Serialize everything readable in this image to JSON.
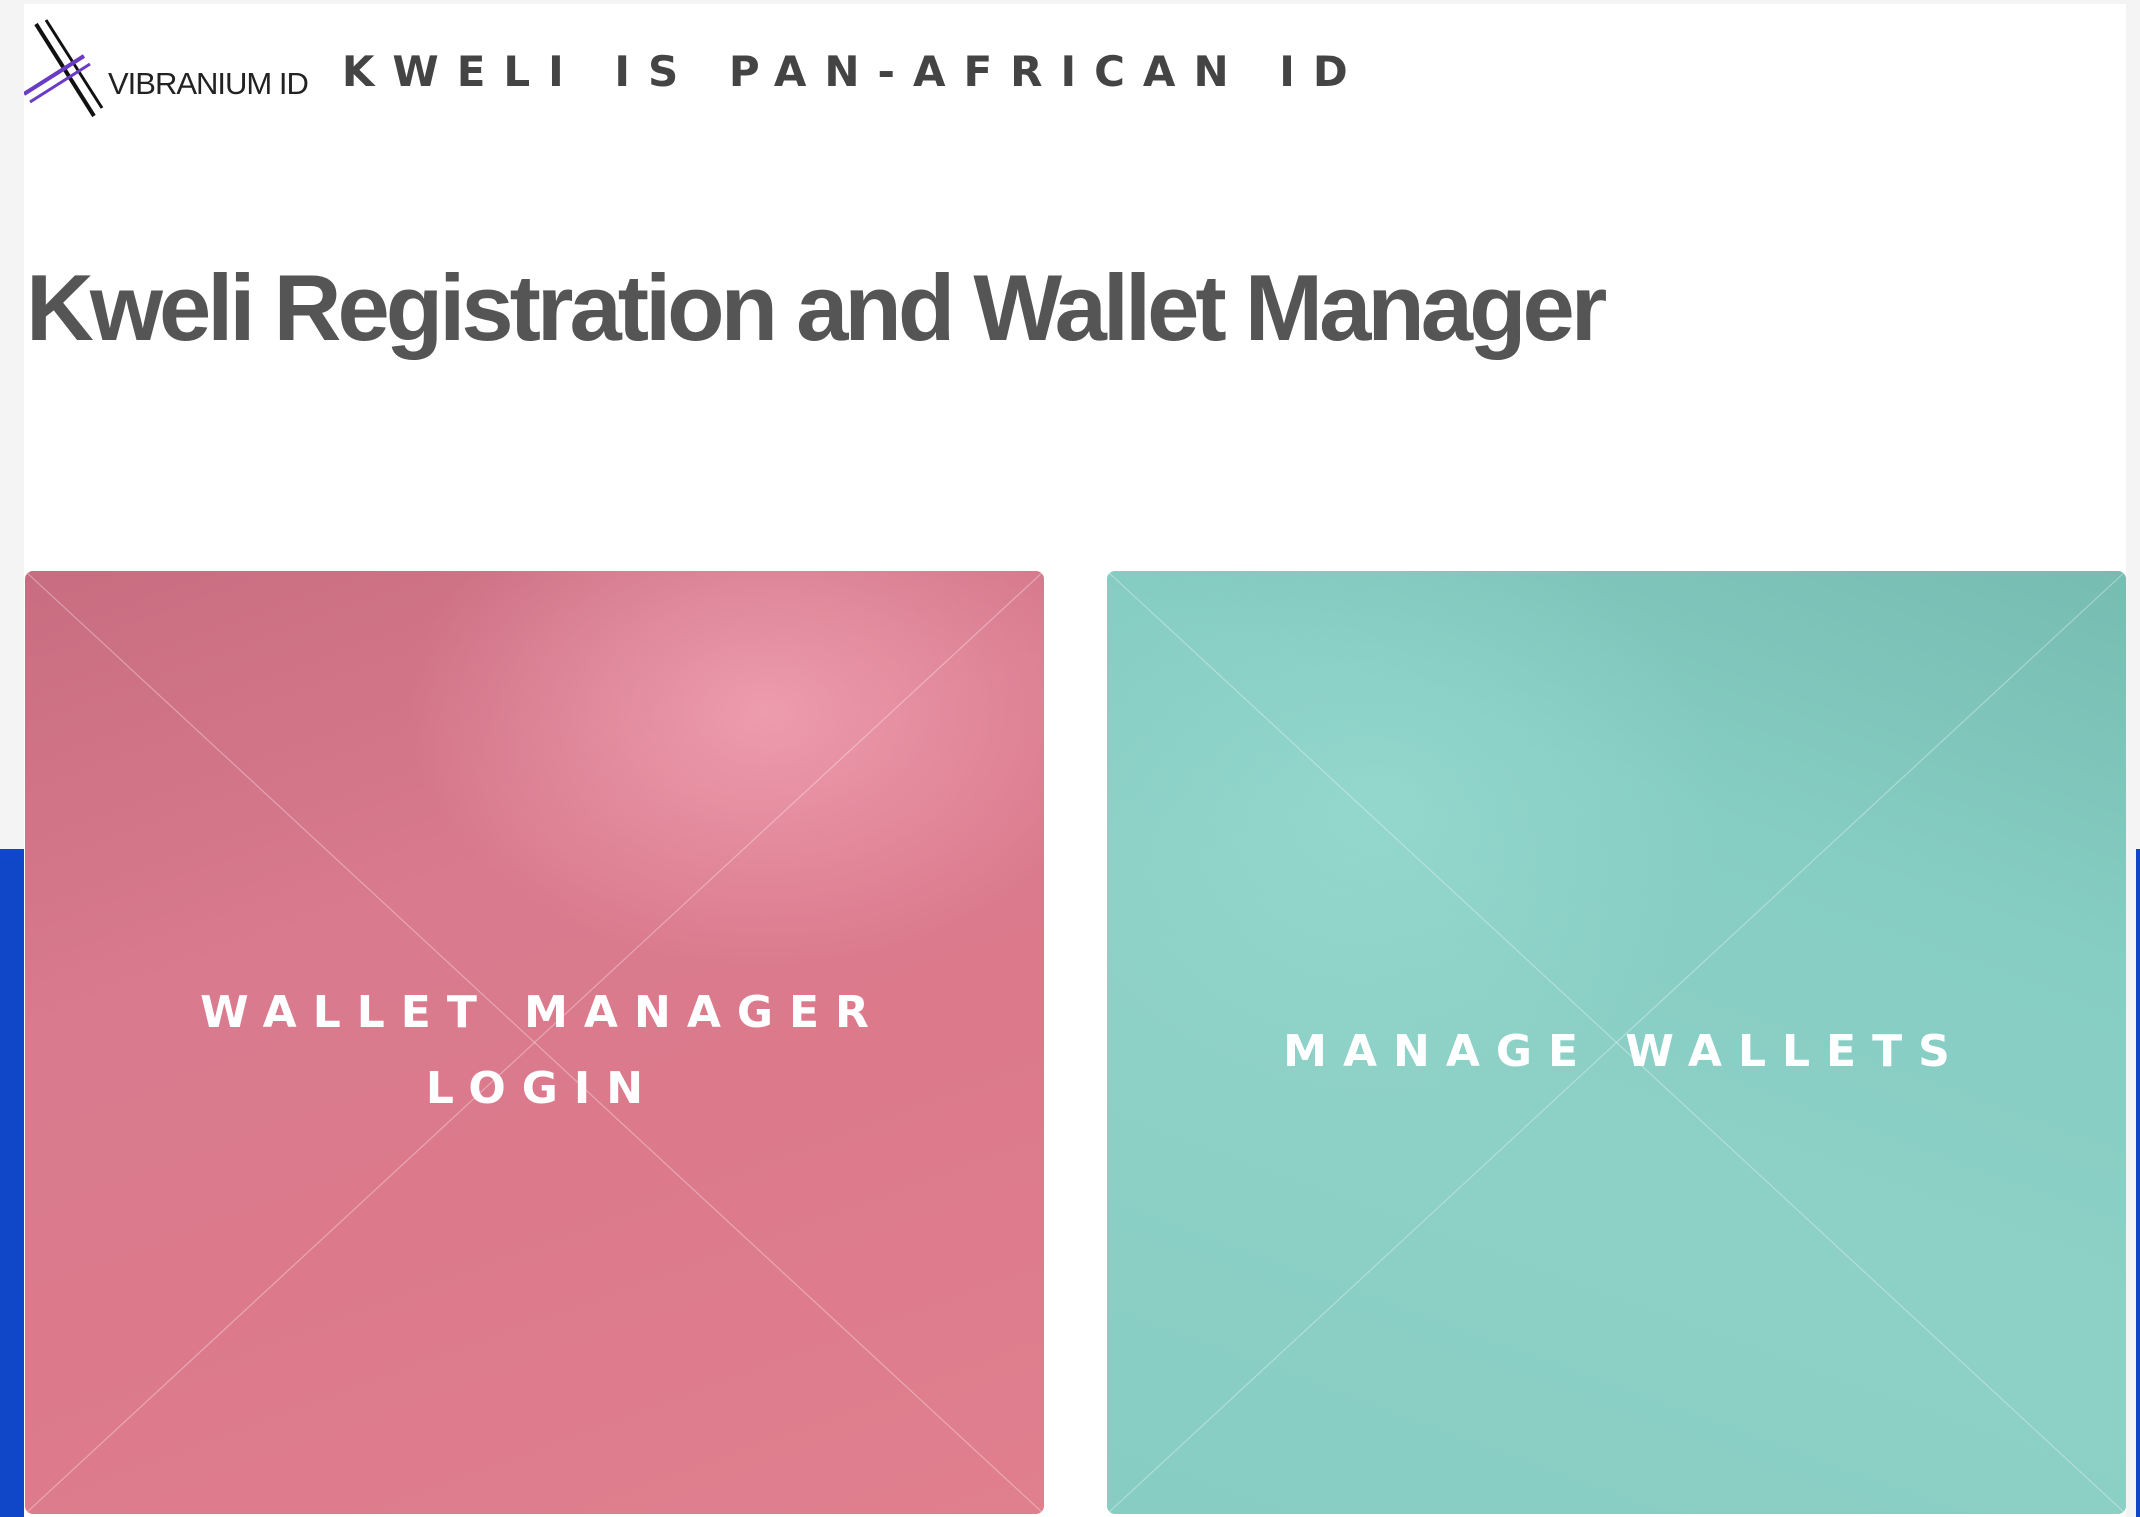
{
  "header": {
    "logo_text": "VIBRANIUM ID",
    "tagline": "KWELI IS PAN-AFRICAN ID"
  },
  "main": {
    "title": "Kweli Registration and Wallet Manager",
    "cards": [
      {
        "label": "WALLET MANAGER LOGIN",
        "color": "#d97a8e"
      },
      {
        "label": "MANAGE WALLETS",
        "color": "#8bd0c6"
      }
    ]
  },
  "colors": {
    "side_accent": "#0f47c8",
    "title_text": "#555555"
  }
}
